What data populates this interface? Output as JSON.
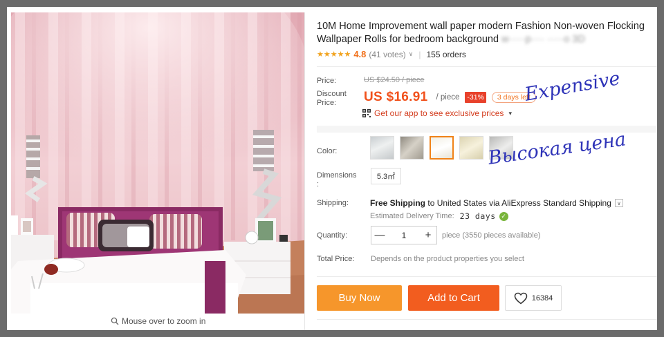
{
  "product": {
    "title_line1": "10M Home Improvement wall paper modern Fashion Non-woven Flocking",
    "title_line2": "Wallpaper Rolls for bedroom background",
    "title_blurred": "w·····p···· ·····o 3D"
  },
  "rating": {
    "stars": "★★★★★",
    "value": "4.8",
    "votes": "(41 votes)",
    "chevron": "∨",
    "orders": "155 orders"
  },
  "price": {
    "label": "Price:",
    "original": "US $24.50 / piece",
    "discount_label_line1": "Discount",
    "discount_label_line2": "Price:",
    "current": "US $16.91",
    "per_unit": "/ piece",
    "discount_badge": "-31%",
    "days_left": "3 days left",
    "app_promo": "Get our app to see exclusive prices",
    "app_chevron": "▾"
  },
  "color": {
    "label": "Color:",
    "swatches": [
      "swatch-1",
      "swatch-2",
      "swatch-3",
      "swatch-4",
      "swatch-5"
    ],
    "selected_index": 2
  },
  "dimensions": {
    "label_line1": "Dimensions",
    "label_line2": ":",
    "value": "5.3㎡"
  },
  "shipping": {
    "label": "Shipping:",
    "free": "Free Shipping",
    "to": "to",
    "destination": "United States via AliExpress Standard Shipping",
    "chevron": "∨",
    "delivery_label": "Estimated Delivery Time:",
    "delivery_days": "23 days",
    "check": "✓"
  },
  "quantity": {
    "label": "Quantity:",
    "minus": "—",
    "value": "1",
    "plus": "+",
    "note": "piece (3550 pieces available)"
  },
  "total": {
    "label": "Total Price:",
    "note": "Depends on the product properties you select"
  },
  "actions": {
    "buy_now": "Buy Now",
    "add_to_cart": "Add to Cart",
    "wishlist_count": "16384"
  },
  "gallery": {
    "zoom_hint": "Mouse over to zoom in"
  },
  "annotations": {
    "english": "Expensive",
    "russian": "Высокая цена",
    "color": "#2f34b8"
  },
  "colors": {
    "price": "#f1511c",
    "buy_now": "#f6962b",
    "add_to_cart": "#f25d1f",
    "star": "#f1a21c"
  }
}
